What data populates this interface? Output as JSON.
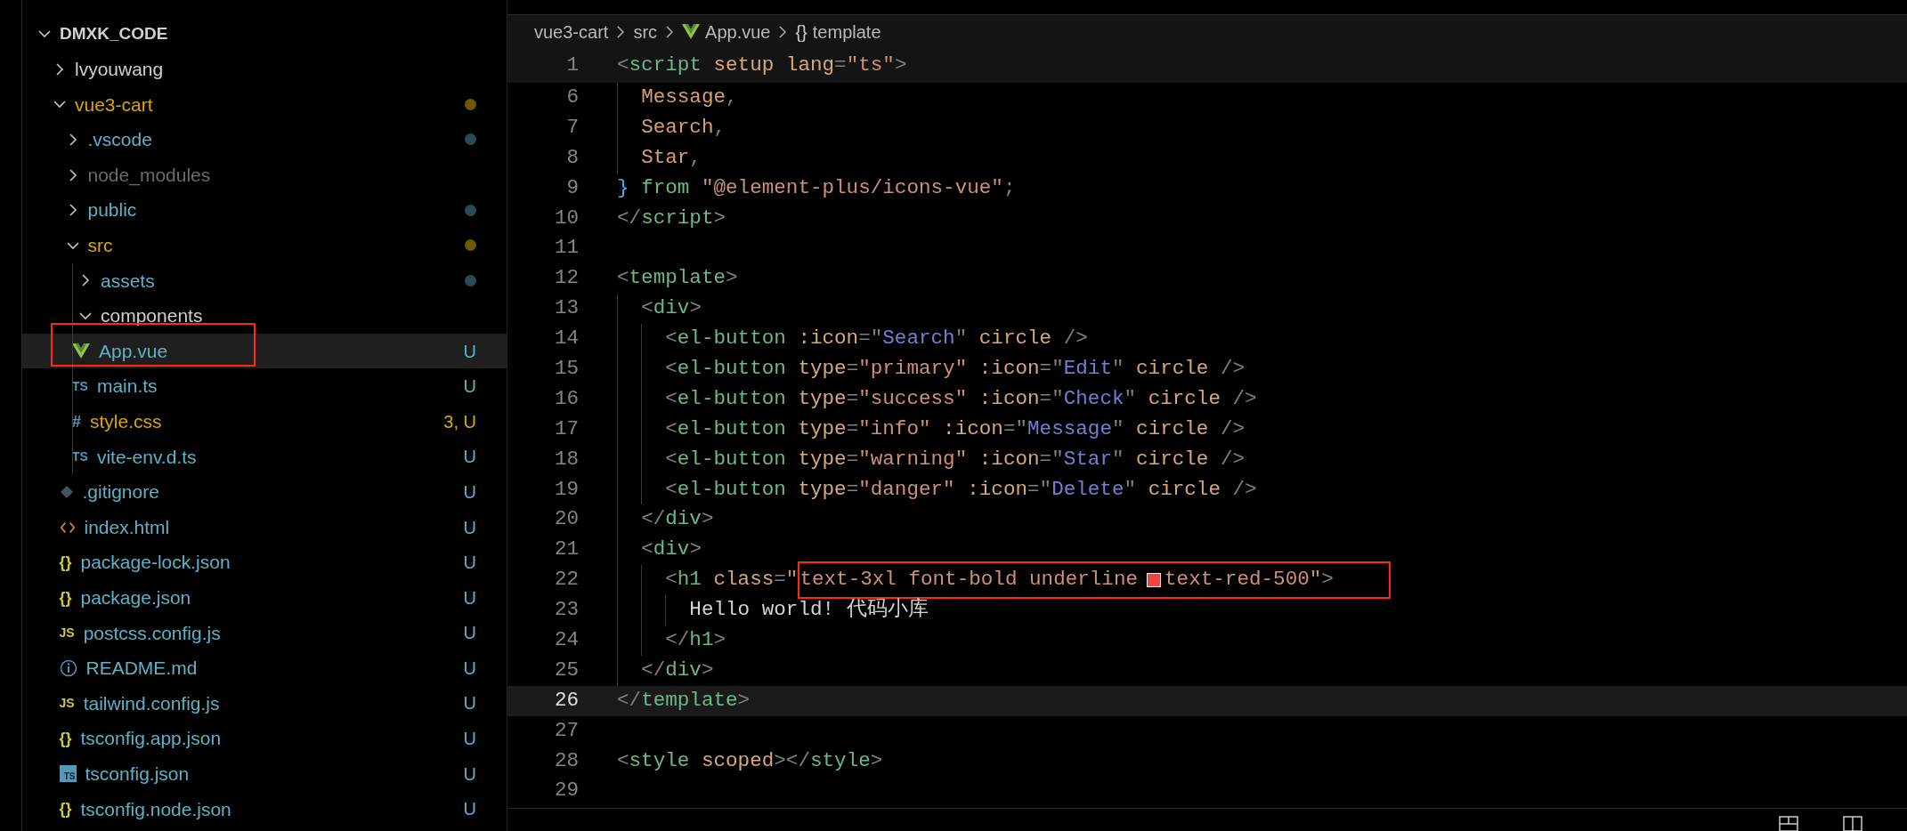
{
  "explorer": {
    "title": "DMXK_CODE",
    "expanded": true,
    "items": [
      {
        "label": "lvyouwang",
        "kind": "folder",
        "expanded": false,
        "selected": false
      },
      {
        "label": "vue3-cart",
        "kind": "folder",
        "expanded": true,
        "modified": true,
        "dot": true,
        "selected": false,
        "children": [
          {
            "label": ".vscode",
            "kind": "folder",
            "expanded": false,
            "untracked": true,
            "dot": true,
            "selected": false
          },
          {
            "label": "node_modules",
            "kind": "folder",
            "expanded": false,
            "ignored": true,
            "selected": false
          },
          {
            "label": "public",
            "kind": "folder",
            "expanded": false,
            "untracked": true,
            "dot": true,
            "selected": false
          },
          {
            "label": "src",
            "kind": "folder",
            "expanded": true,
            "modified": true,
            "dot": true,
            "selected": false,
            "children": [
              {
                "label": "assets",
                "kind": "folder",
                "expanded": false,
                "untracked": true,
                "dot": true,
                "selected": false
              },
              {
                "label": "components",
                "kind": "folder",
                "expanded": true,
                "selected": false
              },
              {
                "label": "App.vue",
                "kind": "vue-file",
                "untracked": true,
                "badge": "U",
                "selected": true,
                "annotated": true
              },
              {
                "label": "main.ts",
                "kind": "ts-file",
                "glyph": "TS",
                "untracked": true,
                "badge": "U",
                "selected": false
              },
              {
                "label": "style.css",
                "kind": "css-file",
                "glyph": "#",
                "untracked": true,
                "modified": true,
                "badge": "3, U",
                "selected": false
              },
              {
                "label": "vite-env.d.ts",
                "kind": "ts-file",
                "glyph": "TS",
                "untracked": true,
                "badge": "U",
                "selected": false
              }
            ]
          },
          {
            "label": ".gitignore",
            "kind": "git-file",
            "untracked": true,
            "badge": "U",
            "selected": false
          },
          {
            "label": "index.html",
            "kind": "html-file",
            "untracked": true,
            "badge": "U",
            "selected": false
          },
          {
            "label": "package-lock.json",
            "kind": "json-file",
            "glyph": "{}",
            "untracked": true,
            "badge": "U",
            "selected": false
          },
          {
            "label": "package.json",
            "kind": "json-file",
            "glyph": "{}",
            "untracked": true,
            "badge": "U",
            "selected": false
          },
          {
            "label": "postcss.config.js",
            "kind": "js-file",
            "glyph": "JS",
            "untracked": true,
            "badge": "U",
            "selected": false
          },
          {
            "label": "README.md",
            "kind": "info-file",
            "untracked": true,
            "badge": "U",
            "selected": false
          },
          {
            "label": "tailwind.config.js",
            "kind": "js-file",
            "glyph": "JS",
            "untracked": true,
            "badge": "U",
            "selected": false
          },
          {
            "label": "tsconfig.app.json",
            "kind": "json-file",
            "glyph": "{}",
            "untracked": true,
            "badge": "U",
            "selected": false
          },
          {
            "label": "tsconfig.json",
            "kind": "tsconfig-file",
            "glyph": "TS",
            "untracked": true,
            "badge": "U",
            "selected": false
          },
          {
            "label": "tsconfig.node.json",
            "kind": "json-file",
            "glyph": "{}",
            "untracked": true,
            "badge": "U",
            "selected": false
          }
        ]
      }
    ]
  },
  "breadcrumb": [
    {
      "label": "vue3-cart",
      "kind": "folder"
    },
    {
      "label": "src",
      "kind": "folder"
    },
    {
      "label": "App.vue",
      "kind": "vue-file"
    },
    {
      "label": "template",
      "kind": "symbol",
      "glyph": "{}"
    }
  ],
  "sticky_line": {
    "number": "1",
    "text": "<script setup lang=\"ts\">"
  },
  "lines": [
    {
      "number": "6",
      "current": false,
      "text": "  Message,"
    },
    {
      "number": "7",
      "current": false,
      "text": "  Search,"
    },
    {
      "number": "8",
      "current": false,
      "text": "  Star,"
    },
    {
      "number": "9",
      "current": false,
      "text": "} from \"@element-plus/icons-vue\";"
    },
    {
      "number": "10",
      "current": false,
      "text": "</script>"
    },
    {
      "number": "11",
      "current": false
    },
    {
      "number": "12",
      "current": false,
      "text": "<template>"
    },
    {
      "number": "13",
      "current": false,
      "text": "  <div>"
    },
    {
      "number": "14",
      "current": false,
      "text": "    <el-button :icon=\"Search\" circle />"
    },
    {
      "number": "15",
      "current": false,
      "text": "    <el-button type=\"primary\" :icon=\"Edit\" circle />"
    },
    {
      "number": "16",
      "current": false,
      "text": "    <el-button type=\"success\" :icon=\"Check\" circle />"
    },
    {
      "number": "17",
      "current": false,
      "text": "    <el-button type=\"info\" :icon=\"Message\" circle />"
    },
    {
      "number": "18",
      "current": false,
      "text": "    <el-button type=\"warning\" :icon=\"Star\" circle />"
    },
    {
      "number": "19",
      "current": false,
      "text": "    <el-button type=\"danger\" :icon=\"Delete\" circle />"
    },
    {
      "number": "20",
      "current": false,
      "text": "  </div>"
    },
    {
      "number": "21",
      "current": false,
      "text": "  <div>"
    },
    {
      "number": "22",
      "current": false,
      "text": "    <h1 class=\"",
      "annotated": [
        "text-3xl font-bold underline",
        "text-red-500\">"
      ],
      "color": "#ef4444"
    },
    {
      "number": "23",
      "current": false,
      "text": "      Hello world! 代码小库"
    },
    {
      "number": "24",
      "current": false,
      "text": "    </h1>"
    },
    {
      "number": "25",
      "current": false,
      "text": "  </div>"
    },
    {
      "number": "26",
      "current": true,
      "text": "</template>"
    },
    {
      "number": "27",
      "current": false
    },
    {
      "number": "28",
      "current": false,
      "text": "<style scoped></style>"
    },
    {
      "number": "29",
      "current": false
    }
  ]
}
